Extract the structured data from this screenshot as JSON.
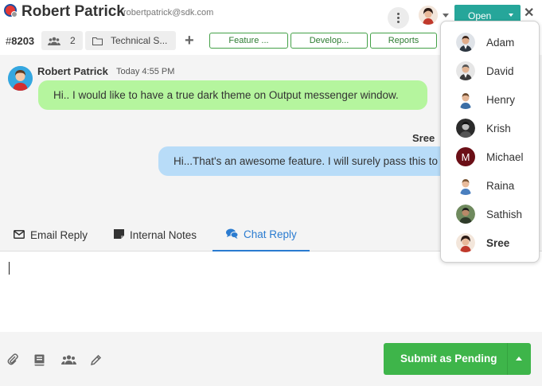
{
  "header": {
    "contact_name": "Robert Patrick",
    "contact_email": "robertpatrick@sdk.com",
    "status_label": "Open",
    "close_glyph": "✕"
  },
  "tagrow": {
    "ticket_prefix": "#",
    "ticket_number": "8203",
    "member_count": "2",
    "category": "Technical S...",
    "add_glyph": "+",
    "tags": [
      "Feature ...",
      "Develop...",
      "Reports"
    ]
  },
  "chat": {
    "incoming": {
      "author": "Robert Patrick",
      "time": "Today 4:55 PM",
      "text": "Hi.. I would like to have a true dark theme on Output messenger window."
    },
    "outgoing": {
      "author": "Sree",
      "text": "Hi...That's an awesome feature. I will surely pass this to our team."
    }
  },
  "reply_tabs": {
    "email": "Email Reply",
    "notes": "Internal Notes",
    "chat": "Chat Reply"
  },
  "footer": {
    "submit_label": "Submit as Pending"
  },
  "assignee_menu": {
    "items": [
      {
        "name": "Adam"
      },
      {
        "name": "David"
      },
      {
        "name": "Henry"
      },
      {
        "name": "Krish"
      },
      {
        "name": "Michael",
        "initial": "M"
      },
      {
        "name": "Raina"
      },
      {
        "name": "Sathish"
      },
      {
        "name": "Sree",
        "selected": true
      }
    ]
  },
  "colors": {
    "status": "#26a69a",
    "submit": "#3eb54a",
    "tag_border": "#43a047",
    "incoming_bubble": "#b5f59e",
    "outgoing_bubble": "#b8dcf8",
    "active_tab": "#2a7bd0"
  }
}
